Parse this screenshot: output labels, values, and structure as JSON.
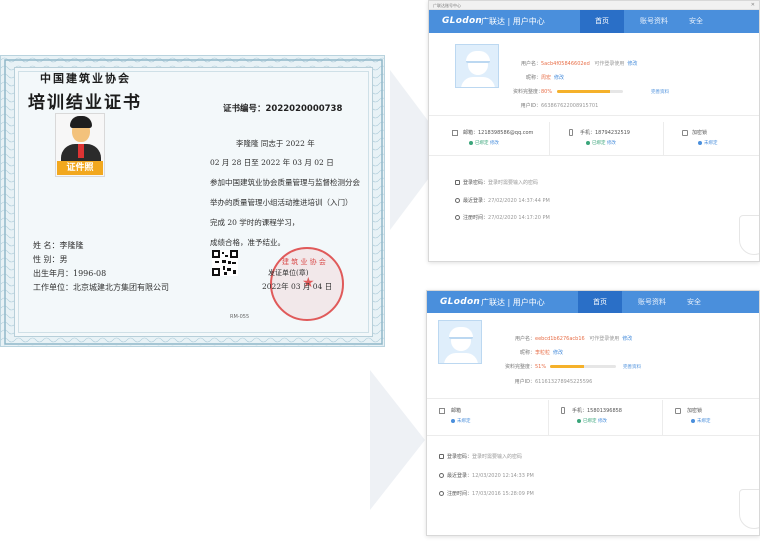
{
  "certificate": {
    "org": "中国建筑业协会",
    "title": "培训结业证书",
    "photo_label": "证件照",
    "cert_no": "证书编号：2022020000738",
    "body_lines": [
      "李隆隆  同志于  2022 年",
      "02 月 28 日至  2022 年 03 月 02 日",
      "参加中国建筑业协会质量管理与监督检测分会",
      "举办的质量管理小组活动推进培训（入门）",
      "完成  20  学时的课程学习，",
      "成绩合格，准予结业。"
    ],
    "name_line": "姓      名：李隆隆",
    "sex_line": "性      别：男",
    "birth_line": "出生年月：1996-08",
    "work_line": "工作单位：北京城建北方集团有限公司",
    "seal_issuer": "发证单位(章)",
    "seal_date": "2022年 03 月 04 日",
    "code": "RM-055"
  },
  "panel1": {
    "titlebar": "广联达账号中心",
    "brand": "GLodon",
    "brand_cn": "广联达 | 用户中心",
    "tabs": [
      "首页",
      "账号资料",
      "安全"
    ],
    "username_label": "用户名：",
    "username": "5acb4f05846602ed",
    "username_note": "可作登录使用",
    "edit": "修改",
    "nickname_label": "昵称：",
    "nickname": "周宏",
    "completeness_label": "资料完整度：",
    "completeness_pct": "80%",
    "completeness_value": 0.8,
    "complete_link": "完善资料",
    "userid_label": "用户ID：",
    "userid": "663867622008915701",
    "email": "邮箱：1218398586@qq.com",
    "email_status": "已绑定",
    "phone": "手机：18794232519",
    "phone_status": "已绑定",
    "encrypt": "加密锁",
    "encrypt_status": "未绑定",
    "log1_label": "登录密码",
    "log1_text": "登录时需要输入的密码",
    "log2_label": "最近登录：",
    "log2_text": "27/02/2020 14:37:44 PM",
    "log3_label": "注册时间：",
    "log3_text": "27/02/2020 14:17:20 PM"
  },
  "panel2": {
    "brand": "GLodon",
    "brand_cn": "广联达 | 用户中心",
    "tabs": [
      "首页",
      "账号资料",
      "安全"
    ],
    "username_label": "用户名：",
    "username": "eebcd1b6276acb16",
    "username_note": "可作登录使用",
    "edit": "修改",
    "nickname_label": "昵称：",
    "nickname": "李粒粒",
    "completeness_label": "资料完整度：",
    "completeness_pct": "51%",
    "completeness_value": 0.51,
    "complete_link": "完善资料",
    "userid_label": "用户ID：",
    "userid": "611613278945225596",
    "email": "邮箱",
    "email_status": "未绑定",
    "phone": "手机：15801396858",
    "phone_status": "已绑定",
    "encrypt": "加密锁",
    "encrypt_status": "未绑定",
    "log1_label": "登录密码",
    "log1_text": "登录时需要输入的密码",
    "log2_label": "最近登录：",
    "log2_text": "12/03/2020 12:14:33 PM",
    "log3_label": "注册时间：",
    "log3_text": "17/03/2016 15:28:09 PM"
  }
}
